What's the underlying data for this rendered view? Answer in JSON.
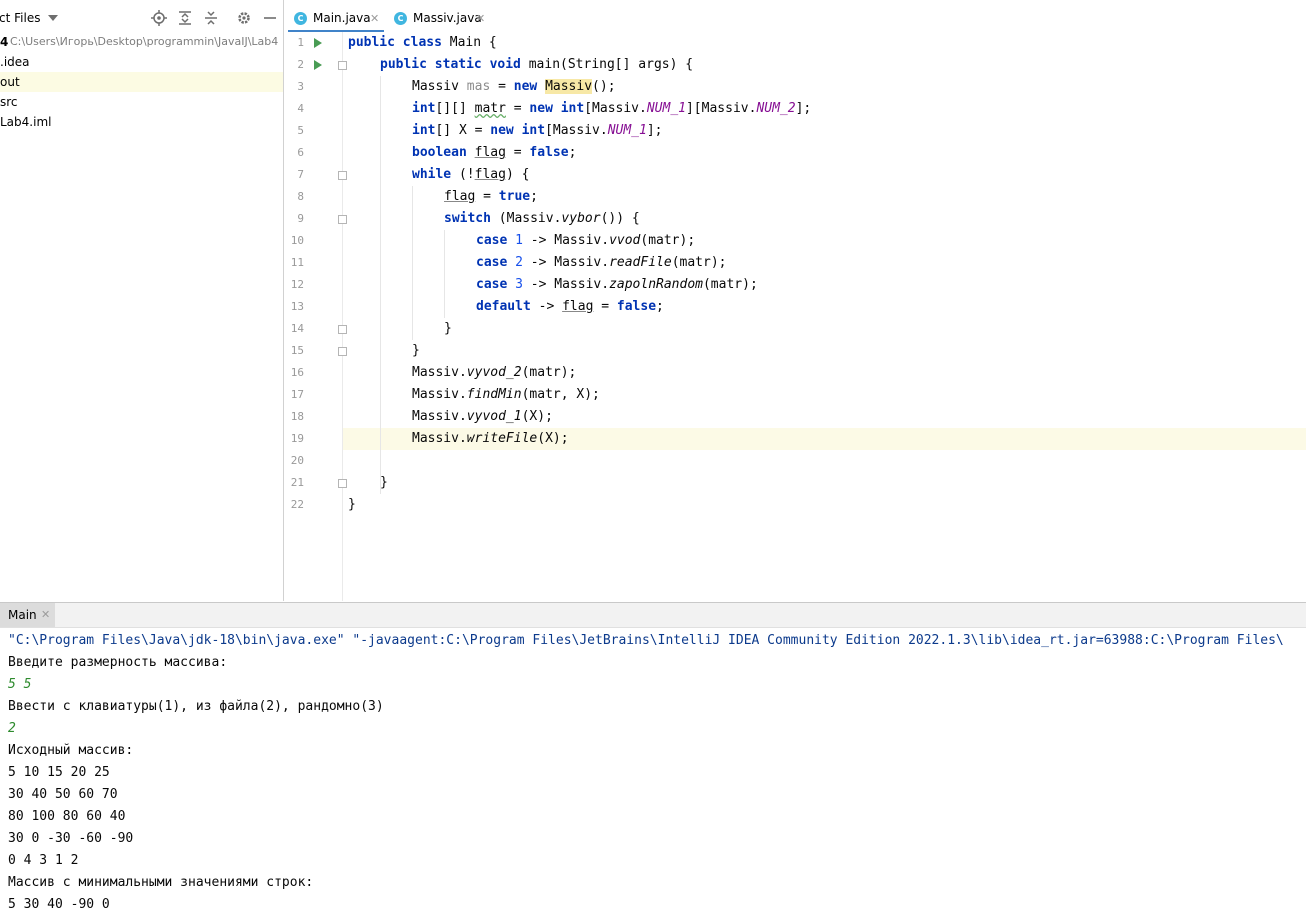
{
  "project": {
    "title": "ct Files",
    "root_label": "4",
    "root_path": "C:\\Users\\Игорь\\Desktop\\programmin\\JavaIJ\\Lab4",
    "items": [
      ".idea",
      "out",
      "src",
      "Lab4.iml"
    ]
  },
  "tabs": [
    {
      "label": "Main.java",
      "icon": "class-icon"
    },
    {
      "label": "Massiv.java",
      "icon": "class-icon"
    }
  ],
  "editor": {
    "line_numbers": [
      "1",
      "2",
      "3",
      "4",
      "5",
      "6",
      "7",
      "8",
      "9",
      "10",
      "11",
      "12",
      "13",
      "14",
      "15",
      "16",
      "17",
      "18",
      "19",
      "20",
      "21",
      "22"
    ],
    "code": {
      "l1": {
        "kw1": "public class",
        "t1": " Main {"
      },
      "l2": {
        "kw1": "public static void",
        "t1": " main(String[] args) {"
      },
      "l3": {
        "t1": "Massiv ",
        "u1": "mas",
        "t2": " = ",
        "kw1": "new",
        "t3": " ",
        "m1": "Massiv",
        "t4": "();"
      },
      "l4": {
        "kw1": "int",
        "t1": "[][] ",
        "w1": "matr",
        "t2": " = ",
        "kw2": "new",
        "t3": " ",
        "kw3": "int",
        "t4": "[Massiv.",
        "f1": "NUM_1",
        "t5": "][Massiv.",
        "f2": "NUM_2",
        "t6": "];"
      },
      "l5": {
        "kw1": "int",
        "t1": "[] X = ",
        "kw2": "new",
        "t2": " ",
        "kw3": "int",
        "t3": "[Massiv.",
        "f1": "NUM_1",
        "t4": "];"
      },
      "l6": {
        "kw1": "boolean",
        "t1": " ",
        "v1": "flag",
        "t2": " = ",
        "kw2": "false",
        "t3": ";"
      },
      "l7": {
        "kw1": "while",
        "t1": " (!",
        "v1": "flag",
        "t2": ") {"
      },
      "l8": {
        "v1": "flag",
        "t1": " = ",
        "kw1": "true",
        "t2": ";"
      },
      "l9": {
        "kw1": "switch",
        "t1": " (Massiv.",
        "s1": "vybor",
        "t2": "()) {"
      },
      "l10": {
        "kw1": "case",
        "t1": " ",
        "n1": "1",
        "t2": " -> Massiv.",
        "s1": "vvod",
        "t3": "(matr);"
      },
      "l11": {
        "kw1": "case",
        "t1": " ",
        "n1": "2",
        "t2": " -> Massiv.",
        "s1": "readFile",
        "t3": "(matr);"
      },
      "l12": {
        "kw1": "case",
        "t1": " ",
        "n1": "3",
        "t2": " -> Massiv.",
        "s1": "zapolnRandom",
        "t3": "(matr);"
      },
      "l13": {
        "kw1": "default",
        "t1": " -> ",
        "v1": "flag",
        "t2": " = ",
        "kw2": "false",
        "t3": ";"
      },
      "l14": {
        "t1": "}"
      },
      "l15": {
        "t1": "}"
      },
      "l16": {
        "t1": "Massiv.",
        "s1": "vyvod_2",
        "t2": "(matr);"
      },
      "l17": {
        "t1": "Massiv.",
        "s1": "findMin",
        "t2": "(matr, X);"
      },
      "l18": {
        "t1": "Massiv.",
        "s1": "vyvod_1",
        "t2": "(X);"
      },
      "l19": {
        "t1": "Massiv.",
        "s1": "writeFile",
        "t2": "(X);"
      },
      "l21": {
        "t1": "}"
      },
      "l22": {
        "t1": "}"
      }
    }
  },
  "run": {
    "tab_label": "Main",
    "console": [
      {
        "text": "\"C:\\Program Files\\Java\\jdk-18\\bin\\java.exe\" \"-javaagent:C:\\Program Files\\JetBrains\\IntelliJ IDEA Community Edition 2022.1.3\\lib\\idea_rt.jar=63988:C:\\Program Files\\",
        "kind": "cmd"
      },
      {
        "text": "Введите размерность массива:",
        "kind": "out"
      },
      {
        "text": "5 5",
        "kind": "in"
      },
      {
        "text": "Ввести с клавиатуры(1), из файла(2), рандомно(3)",
        "kind": "out"
      },
      {
        "text": "2",
        "kind": "in"
      },
      {
        "text": "Исходный массив:",
        "kind": "out"
      },
      {
        "text": "5 10 15 20 25",
        "kind": "out"
      },
      {
        "text": "30 40 50 60 70",
        "kind": "out"
      },
      {
        "text": "80 100 80 60 40",
        "kind": "out"
      },
      {
        "text": "30 0 -30 -60 -90",
        "kind": "out"
      },
      {
        "text": "0 4 3 1 2",
        "kind": "out"
      },
      {
        "text": "Массив с минимальными значениями строк:",
        "kind": "out"
      },
      {
        "text": "5 30 40 -90 0",
        "kind": "out"
      }
    ]
  },
  "colors": {
    "keyword": "#0033b3",
    "field": "#871094",
    "number": "#1750eb",
    "accent": "#4083c9",
    "run_icon": "#499c54"
  }
}
